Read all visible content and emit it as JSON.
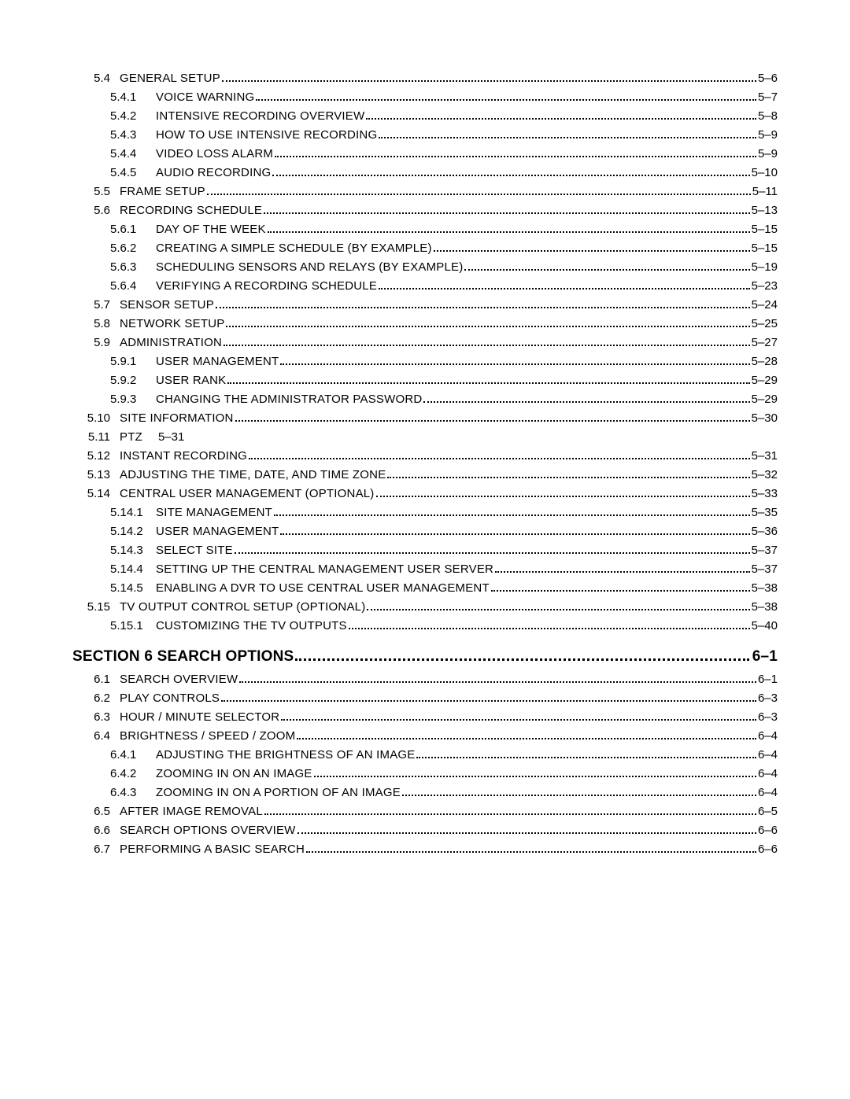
{
  "entries": [
    {
      "kind": "l1",
      "num": "5.4",
      "title": "GENERAL SETUP",
      "page": "5–6"
    },
    {
      "kind": "l2",
      "num": "5.4.1",
      "title": "VOICE WARNING",
      "page": "5–7"
    },
    {
      "kind": "l2",
      "num": "5.4.2",
      "title": "INTENSIVE RECORDING OVERVIEW",
      "page": "5–8"
    },
    {
      "kind": "l2",
      "num": "5.4.3",
      "title": "HOW TO USE INTENSIVE RECORDING",
      "page": "5–9"
    },
    {
      "kind": "l2",
      "num": "5.4.4",
      "title": "VIDEO LOSS ALARM",
      "page": "5–9"
    },
    {
      "kind": "l2",
      "num": "5.4.5",
      "title": "AUDIO RECORDING",
      "page": "5–10"
    },
    {
      "kind": "l1",
      "num": "5.5",
      "title": "FRAME SETUP",
      "page": "5–11"
    },
    {
      "kind": "l1",
      "num": "5.6",
      "title": "RECORDING SCHEDULE",
      "page": "5–13"
    },
    {
      "kind": "l2",
      "num": "5.6.1",
      "title": "DAY OF THE WEEK",
      "page": "5–15"
    },
    {
      "kind": "l2",
      "num": "5.6.2",
      "title": "CREATING A SIMPLE SCHEDULE (BY EXAMPLE)",
      "page": "5–15"
    },
    {
      "kind": "l2",
      "num": "5.6.3",
      "title": "SCHEDULING SENSORS AND RELAYS (BY EXAMPLE)",
      "page": "5–19"
    },
    {
      "kind": "l2",
      "num": "5.6.4",
      "title": "VERIFYING A RECORDING SCHEDULE",
      "page": "5–23"
    },
    {
      "kind": "l1",
      "num": "5.7",
      "title": "SENSOR SETUP",
      "page": "5–24"
    },
    {
      "kind": "l1",
      "num": "5.8",
      "title": "NETWORK SETUP",
      "page": "5–25"
    },
    {
      "kind": "l1",
      "num": "5.9",
      "title": "ADMINISTRATION",
      "page": "5–27"
    },
    {
      "kind": "l2",
      "num": "5.9.1",
      "title": "USER MANAGEMENT",
      "page": "5–28"
    },
    {
      "kind": "l2",
      "num": "5.9.2",
      "title": "USER RANK",
      "page": "5–29"
    },
    {
      "kind": "l2",
      "num": "5.9.3",
      "title": "CHANGING THE ADMINISTRATOR PASSWORD",
      "page": "5–29"
    },
    {
      "kind": "l1",
      "num": "5.10",
      "title": "SITE INFORMATION",
      "page": "5–30"
    },
    {
      "kind": "ptz",
      "num": "5.11",
      "title": "PTZ",
      "page": "5–31"
    },
    {
      "kind": "l1",
      "num": "5.12",
      "title": "INSTANT RECORDING",
      "page": "5–31"
    },
    {
      "kind": "l1",
      "num": "5.13",
      "title": "ADJUSTING THE TIME, DATE, AND TIME ZONE",
      "page": "5–32"
    },
    {
      "kind": "l1",
      "num": "5.14",
      "title": "CENTRAL USER MANAGEMENT (OPTIONAL)",
      "page": "5–33"
    },
    {
      "kind": "l2",
      "num": "5.14.1",
      "title": "SITE MANAGEMENT",
      "page": "5–35"
    },
    {
      "kind": "l2",
      "num": "5.14.2",
      "title": "USER MANAGEMENT",
      "page": "5–36"
    },
    {
      "kind": "l2",
      "num": "5.14.3",
      "title": "SELECT SITE",
      "page": "5–37"
    },
    {
      "kind": "l2",
      "num": "5.14.4",
      "title": "SETTING UP THE CENTRAL MANAGEMENT USER SERVER",
      "page": "5–37"
    },
    {
      "kind": "l2",
      "num": "5.14.5",
      "title": "ENABLING A DVR TO USE CENTRAL USER MANAGEMENT",
      "page": "5–38"
    },
    {
      "kind": "l1",
      "num": "5.15",
      "title": "TV OUTPUT CONTROL SETUP (OPTIONAL)",
      "page": "5–38"
    },
    {
      "kind": "l2",
      "num": "5.15.1",
      "title": "CUSTOMIZING THE TV OUTPUTS",
      "page": "5–40"
    },
    {
      "kind": "section",
      "title": "SECTION 6 SEARCH OPTIONS",
      "page": "6–1"
    },
    {
      "kind": "l1",
      "num": "6.1",
      "title": "SEARCH OVERVIEW",
      "page": "6–1"
    },
    {
      "kind": "l1",
      "num": "6.2",
      "title": "PLAY CONTROLS",
      "page": "6–3"
    },
    {
      "kind": "l1",
      "num": "6.3",
      "title": "HOUR / MINUTE SELECTOR",
      "page": "6–3"
    },
    {
      "kind": "l1",
      "num": "6.4",
      "title": "BRIGHTNESS / SPEED / ZOOM",
      "page": "6–4"
    },
    {
      "kind": "l2",
      "num": "6.4.1",
      "title": "ADJUSTING THE BRIGHTNESS OF AN IMAGE",
      "page": "6–4"
    },
    {
      "kind": "l2",
      "num": "6.4.2",
      "title": "ZOOMING IN ON AN IMAGE",
      "page": "6–4"
    },
    {
      "kind": "l2",
      "num": "6.4.3",
      "title": "ZOOMING IN ON A PORTION OF AN IMAGE",
      "page": "6–4"
    },
    {
      "kind": "l1",
      "num": "6.5",
      "title": "AFTER IMAGE REMOVAL",
      "page": "6–5"
    },
    {
      "kind": "l1",
      "num": "6.6",
      "title": "SEARCH OPTIONS OVERVIEW",
      "page": "6–6"
    },
    {
      "kind": "l1",
      "num": "6.7",
      "title": "PERFORMING A BASIC SEARCH",
      "page": "6–6"
    }
  ]
}
